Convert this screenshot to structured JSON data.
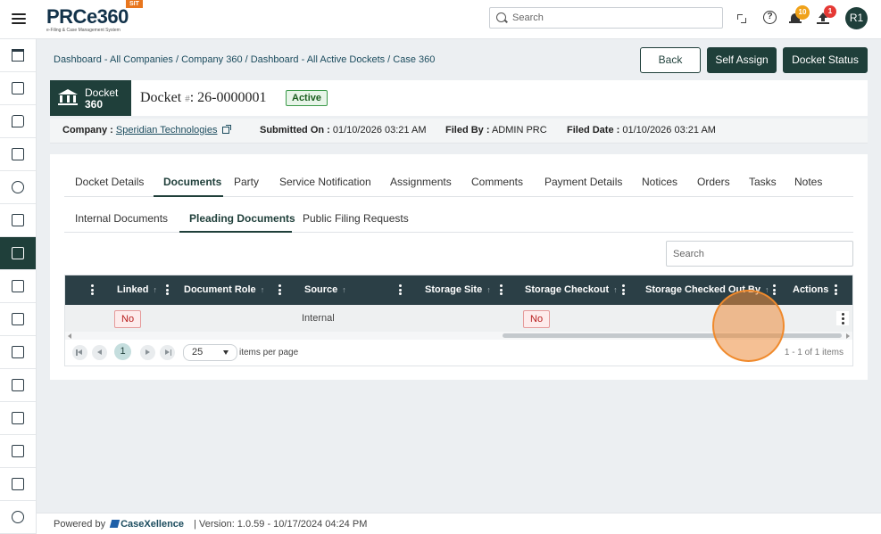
{
  "header": {
    "logo_text": "PRCe360",
    "logo_subtitle": "e-Filing & Case Management System",
    "env_badge": "SIT",
    "search_placeholder": "Search",
    "notifications_count": "10",
    "uploads_count": "1",
    "avatar_initials": "R1"
  },
  "breadcrumb": "Dashboard - All Companies / Company 360 / Dashboard - All Active Dockets / Case 360",
  "actions": {
    "back": "Back",
    "self_assign": "Self Assign",
    "docket_status": "Docket Status"
  },
  "docket": {
    "brand_line1": "Docket",
    "brand_line2": "360",
    "title_prefix": "Docket",
    "title_hash": "#",
    "number": ": 26-0000001",
    "status": "Active"
  },
  "meta": {
    "company_label": "Company :",
    "company_value": "Speridian Technologies",
    "submitted_label": "Submitted On :",
    "submitted_value": "01/10/2026 03:21 AM",
    "filed_by_label": "Filed By :",
    "filed_by_value": "ADMIN PRC",
    "filed_date_label": "Filed Date :",
    "filed_date_value": "01/10/2026 03:21 AM"
  },
  "tabs": [
    "Docket Details",
    "Documents",
    "Party",
    "Service Notification",
    "Assignments",
    "Comments",
    "Payment Details",
    "Notices",
    "Orders",
    "Tasks",
    "Notes"
  ],
  "active_tab": "Documents",
  "subtabs": [
    "Internal Documents",
    "Pleading Documents",
    "Public Filing Requests"
  ],
  "active_subtab": "Pleading Documents",
  "table": {
    "search_placeholder": "Search",
    "columns": [
      "Linked",
      "Document Role",
      "Source",
      "Storage Site",
      "Storage Checkout",
      "Storage Checked Out By",
      "Actions"
    ],
    "rows": [
      {
        "linked": "No",
        "document_role": "",
        "source": "Internal",
        "storage_site": "",
        "storage_checkout": "No",
        "storage_checked_out_by": ""
      }
    ],
    "sort_glyph": "↑",
    "pager": {
      "current_page": "1",
      "page_size": "25",
      "items_per_page_label": "items per page",
      "count_label": "1 - 1 of 1 items"
    }
  },
  "footer": {
    "powered_by": "Powered by",
    "brand": "CaseXellence",
    "version": "|  Version: 1.0.59 - 10/17/2024 04:24 PM"
  }
}
